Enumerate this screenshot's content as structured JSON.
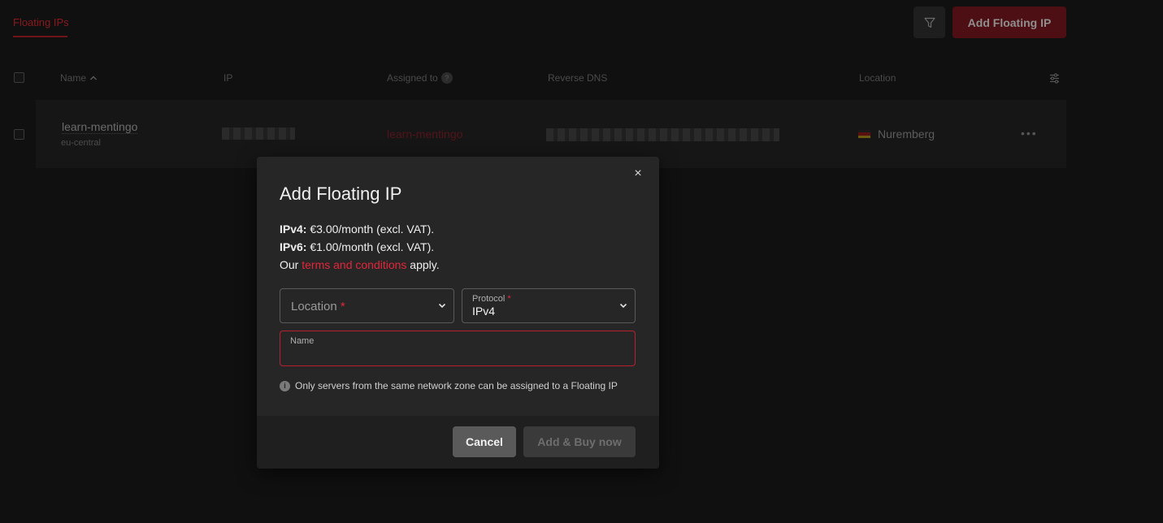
{
  "header": {
    "tab_label": "Floating IPs",
    "add_button_label": "Add Floating IP",
    "filter_icon": "filter-icon"
  },
  "table": {
    "columns": {
      "name": "Name",
      "ip": "IP",
      "assigned_to": "Assigned to",
      "reverse_dns": "Reverse DNS",
      "location": "Location"
    },
    "help_glyph": "?",
    "rows": [
      {
        "name": "learn-mentingo",
        "zone": "eu-central",
        "assigned_to": "learn-mentingo",
        "location": "Nuremberg",
        "actions": "•••"
      }
    ]
  },
  "modal": {
    "title": "Add Floating IP",
    "close_glyph": "×",
    "ipv4_label": "IPv4:",
    "ipv4_price": " €3.00/month (excl. VAT).",
    "ipv6_label": "IPv6:",
    "ipv6_price": " €1.00/month (excl. VAT).",
    "terms_prefix": "Our ",
    "terms_link": "terms and conditions",
    "terms_suffix": " apply.",
    "location_placeholder": "Location",
    "required_mark": "*",
    "protocol_label": "Protocol",
    "protocol_value": "IPv4",
    "name_label": "Name",
    "info_glyph": "i",
    "hint": "Only servers from the same network zone can be assigned to a Floating IP",
    "cancel_label": "Cancel",
    "buy_label": "Add & Buy now"
  },
  "colors": {
    "accent": "#e3263a",
    "background": "#101010",
    "modal_bg": "#262626"
  }
}
